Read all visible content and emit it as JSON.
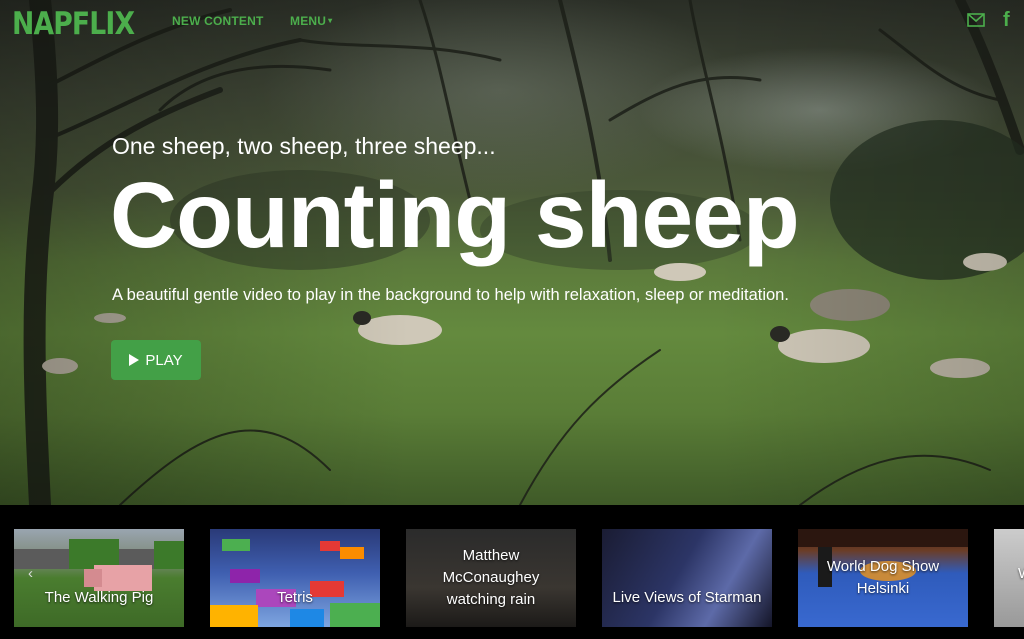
{
  "nav": {
    "logo": "NAPFLIX",
    "new_content": "NEW CONTENT",
    "menu": "MENU",
    "caret": "▾",
    "facebook": "f"
  },
  "hero": {
    "tagline": "One sheep, two sheep, three sheep...",
    "title": "Counting sheep",
    "description": "A beautiful gentle video to play in the background to help with relaxation, sleep or meditation.",
    "play_label": "PLAY"
  },
  "carousel": {
    "items": [
      {
        "label": "The Walking Pig"
      },
      {
        "label": "Tetris"
      },
      {
        "label": "Matthew McConaughey watching rain"
      },
      {
        "label": "Live Views of Starman"
      },
      {
        "label": "World Dog Show Helsinki"
      },
      {
        "label": "W"
      }
    ],
    "arrow_left": "‹"
  },
  "colors": {
    "brand_green": "#4cae4c",
    "play_button": "#43a047",
    "background": "#000000"
  },
  "icons": [
    "mail-icon",
    "facebook-icon",
    "play-icon",
    "chevron-left-icon"
  ]
}
